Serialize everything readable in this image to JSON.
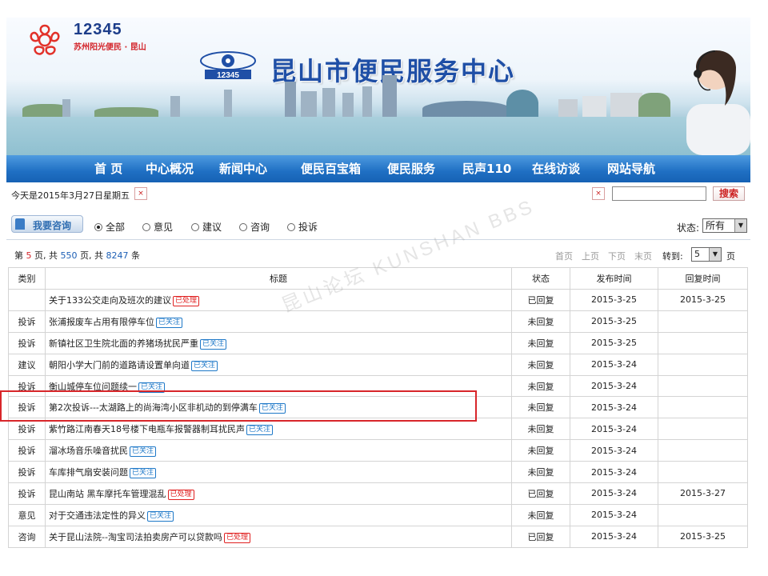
{
  "header": {
    "logo_number": "12345",
    "logo_tagline": "苏州阳光便民 · 昆山",
    "site_title": "昆山市便民服务中心"
  },
  "nav": {
    "items": [
      "首 页",
      "中心概况",
      "新闻中心",
      "便民百宝箱",
      "便民服务",
      "民声110",
      "在线访谈",
      "网站导航"
    ]
  },
  "datebar": {
    "date_text": "今天是2015年3月27日星期五",
    "search_value": "",
    "search_button": "搜索"
  },
  "filter": {
    "consult_button": "我要咨询",
    "options": [
      "全部",
      "意见",
      "建议",
      "咨询",
      "投诉"
    ],
    "selected_option": "全部",
    "status_label": "状态:",
    "status_value": "所有"
  },
  "pager": {
    "prefix": "第 ",
    "current_page": "5",
    "mid1": " 页, 共 ",
    "total_pages": "550",
    "mid2": " 页, 共 ",
    "total_items": "8247",
    "suffix": " 条",
    "links": [
      "首页",
      "上页",
      "下页",
      "末页"
    ],
    "goto_label": "转到:",
    "goto_value": "5",
    "goto_suffix": "页"
  },
  "table": {
    "headers": [
      "类别",
      "标题",
      "状态",
      "发布时间",
      "回复时间"
    ],
    "rows": [
      {
        "category": "",
        "title": "关于133公交走向及班次的建议",
        "tag": "已处理",
        "status": "已回复",
        "published": "2015-3-25",
        "replied": "2015-3-25"
      },
      {
        "category": "投诉",
        "title": "张浦报废车占用有限停车位",
        "tag": "已关注",
        "status": "未回复",
        "published": "2015-3-25",
        "replied": ""
      },
      {
        "category": "投诉",
        "title": "新镇社区卫生院北面的养猪场扰民严重",
        "tag": "已关注",
        "status": "未回复",
        "published": "2015-3-25",
        "replied": ""
      },
      {
        "category": "建议",
        "title": "朝阳小学大门前的道路请设置单向道",
        "tag": "已关注",
        "status": "未回复",
        "published": "2015-3-24",
        "replied": ""
      },
      {
        "category": "投诉",
        "title": "衡山城停车位问题续一",
        "tag": "已关注",
        "status": "未回复",
        "published": "2015-3-24",
        "replied": ""
      },
      {
        "category": "投诉",
        "title": "第2次投诉---太湖路上的尚海湾小区非机动的到停满车",
        "tag": "已关注",
        "status": "未回复",
        "published": "2015-3-24",
        "replied": ""
      },
      {
        "category": "投诉",
        "title": "紫竹路江南春天18号楼下电瓶车报警器制耳扰民声",
        "tag": "已关注",
        "status": "未回复",
        "published": "2015-3-24",
        "replied": ""
      },
      {
        "category": "投诉",
        "title": "溜冰场音乐噪音扰民",
        "tag": "已关注",
        "status": "未回复",
        "published": "2015-3-24",
        "replied": ""
      },
      {
        "category": "投诉",
        "title": "车库排气扇安装问题",
        "tag": "已关注",
        "status": "未回复",
        "published": "2015-3-24",
        "replied": ""
      },
      {
        "category": "投诉",
        "title": "昆山南站 黑车摩托车管理混乱",
        "tag": "已处理",
        "status": "已回复",
        "published": "2015-3-24",
        "replied": "2015-3-27"
      },
      {
        "category": "意见",
        "title": "对于交通违法定性的异义",
        "tag": "已关注",
        "status": "未回复",
        "published": "2015-3-24",
        "replied": ""
      },
      {
        "category": "咨询",
        "title": "关于昆山法院--淘宝司法拍卖房产可以贷款吗",
        "tag": "已处理",
        "status": "已回复",
        "published": "2015-3-24",
        "replied": "2015-3-25"
      }
    ]
  },
  "watermark": "昆山论坛 KUNSHAN BBS",
  "colors": {
    "nav_blue": "#1f6fc3",
    "title_blue": "#1f4fa6",
    "accent_red": "#d8262a",
    "tag_blue": "#1e78c8"
  }
}
